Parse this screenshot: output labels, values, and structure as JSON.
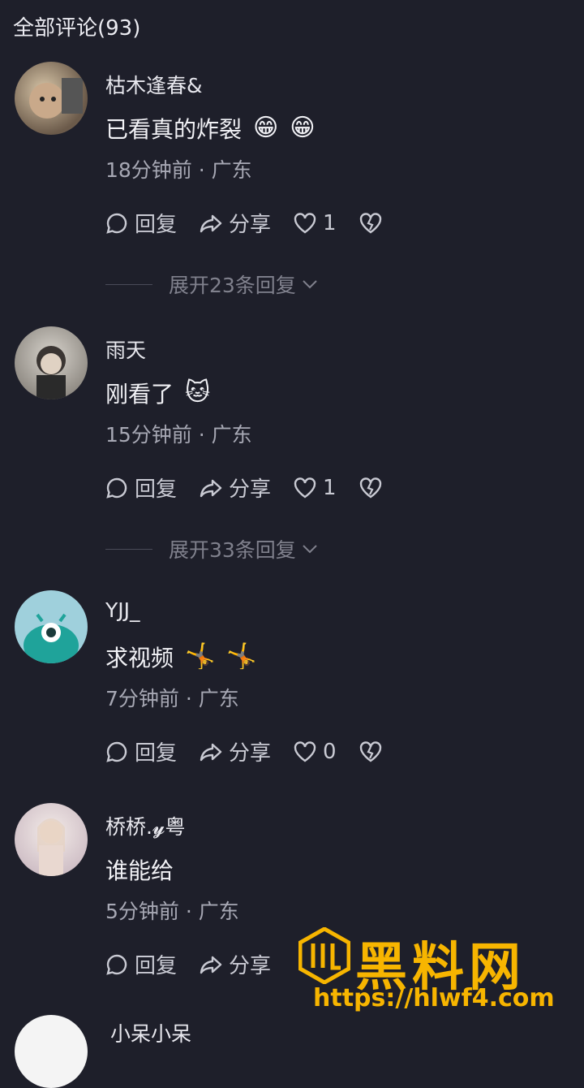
{
  "header": {
    "title": "全部评论(93)"
  },
  "comments": [
    {
      "username": "枯木逢春&",
      "text": "已看真的炸裂",
      "emojis": [
        "😁",
        "😁"
      ],
      "meta": "18分钟前 · 广东",
      "reply": "回复",
      "share": "分享",
      "likes": "1",
      "expand": "展开23条回复"
    },
    {
      "username": "雨天",
      "text": "刚看了",
      "emojis": [
        "🐱"
      ],
      "meta": "15分钟前 · 广东",
      "reply": "回复",
      "share": "分享",
      "likes": "1",
      "expand": "展开33条回复"
    },
    {
      "username": "YJJ_",
      "text": "求视频",
      "emojis": [
        "🤸",
        "🤸"
      ],
      "meta": "7分钟前 · 广东",
      "reply": "回复",
      "share": "分享",
      "likes": "0"
    },
    {
      "username": "桥桥.𝔂粤",
      "text": "谁能给",
      "emojis": [],
      "meta": "5分钟前 · 广东",
      "reply": "回复",
      "share": "分享"
    },
    {
      "username": "小呆小呆"
    }
  ],
  "watermark": {
    "title": "黑料网",
    "url": "https://hlwf4.com"
  }
}
